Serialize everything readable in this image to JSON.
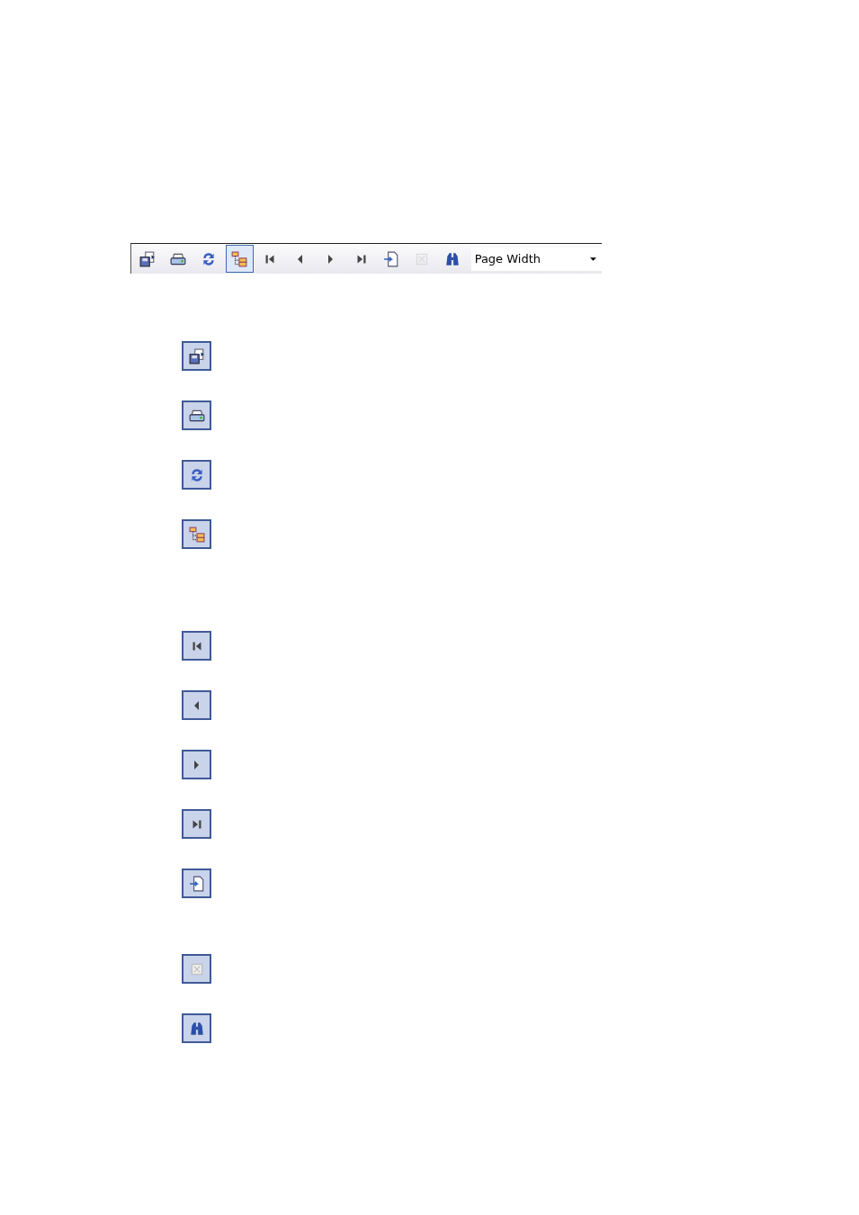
{
  "toolbar": {
    "buttons": [
      {
        "kind": "export",
        "selected": false,
        "disabled": false
      },
      {
        "kind": "print",
        "selected": false,
        "disabled": false
      },
      {
        "kind": "refresh",
        "selected": false,
        "disabled": false
      },
      {
        "kind": "tree",
        "selected": true,
        "disabled": false
      },
      {
        "kind": "first",
        "selected": false,
        "disabled": false
      },
      {
        "kind": "previous",
        "selected": false,
        "disabled": false
      },
      {
        "kind": "next",
        "selected": false,
        "disabled": false
      },
      {
        "kind": "last",
        "selected": false,
        "disabled": false
      },
      {
        "kind": "goto",
        "selected": false,
        "disabled": false
      },
      {
        "kind": "stop",
        "selected": false,
        "disabled": true
      },
      {
        "kind": "find",
        "selected": false,
        "disabled": false
      }
    ],
    "zoom": {
      "value": "Page Width"
    }
  },
  "icon_groups": [
    [
      {
        "kind": "export"
      },
      {
        "kind": "print"
      },
      {
        "kind": "refresh"
      },
      {
        "kind": "tree"
      }
    ],
    [
      {
        "kind": "first"
      },
      {
        "kind": "previous"
      },
      {
        "kind": "next"
      },
      {
        "kind": "last"
      },
      {
        "kind": "goto"
      }
    ],
    [
      {
        "kind": "stop"
      },
      {
        "kind": "find"
      }
    ]
  ]
}
